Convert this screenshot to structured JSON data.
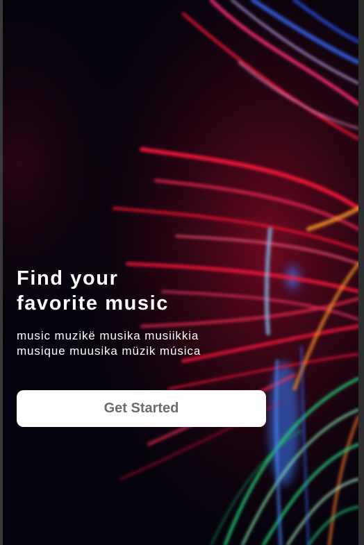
{
  "hero": {
    "title_line1": "Find your",
    "title_line2": "favorite music",
    "tagline_line1": "music muzikë musika musiikkia",
    "tagline_line2": "musique muusika müzik música"
  },
  "cta": {
    "label": "Get Started"
  },
  "background": {
    "image": "light-streaks-photo",
    "colors": [
      "#05030d",
      "#ff1a3c",
      "#ff2d8a",
      "#3a6bff",
      "#2ad17a",
      "#ff9a2a"
    ]
  }
}
